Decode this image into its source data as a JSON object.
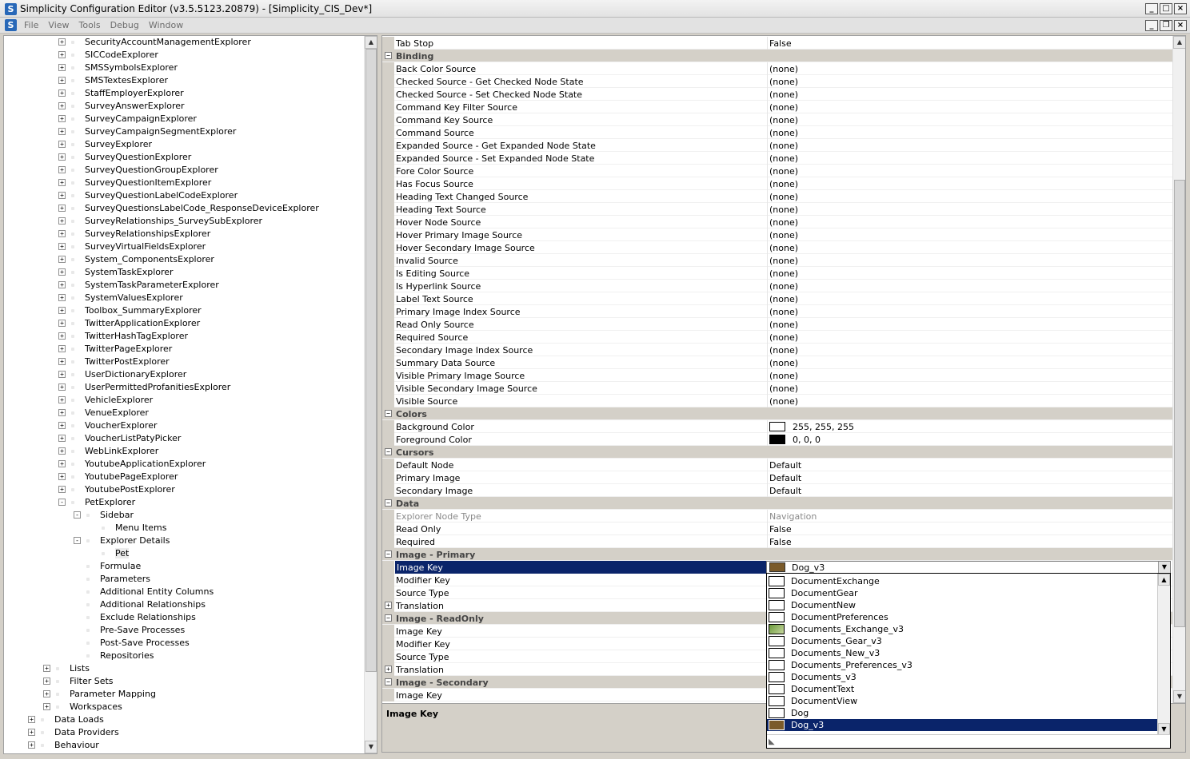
{
  "window": {
    "title": "Simplicity Configuration Editor (v3.5.5123.20879) - [Simplicity_CIS_Dev*]"
  },
  "menu": [
    "File",
    "View",
    "Tools",
    "Debug",
    "Window"
  ],
  "tree": [
    {
      "label": "SecurityAccountManagementExplorer",
      "level": 2,
      "exp": "+"
    },
    {
      "label": "SICCodeExplorer",
      "level": 2,
      "exp": "+"
    },
    {
      "label": "SMSSymbolsExplorer",
      "level": 2,
      "exp": "+"
    },
    {
      "label": "SMSTextesExplorer",
      "level": 2,
      "exp": "+"
    },
    {
      "label": "StaffEmployerExplorer",
      "level": 2,
      "exp": "+"
    },
    {
      "label": "SurveyAnswerExplorer",
      "level": 2,
      "exp": "+"
    },
    {
      "label": "SurveyCampaignExplorer",
      "level": 2,
      "exp": "+"
    },
    {
      "label": "SurveyCampaignSegmentExplorer",
      "level": 2,
      "exp": "+"
    },
    {
      "label": "SurveyExplorer",
      "level": 2,
      "exp": "+"
    },
    {
      "label": "SurveyQuestionExplorer",
      "level": 2,
      "exp": "+"
    },
    {
      "label": "SurveyQuestionGroupExplorer",
      "level": 2,
      "exp": "+"
    },
    {
      "label": "SurveyQuestionItemExplorer",
      "level": 2,
      "exp": "+"
    },
    {
      "label": "SurveyQuestionLabelCodeExplorer",
      "level": 2,
      "exp": "+"
    },
    {
      "label": "SurveyQuestionsLabelCode_ResponseDeviceExplorer",
      "level": 2,
      "exp": "+"
    },
    {
      "label": "SurveyRelationships_SurveySubExplorer",
      "level": 2,
      "exp": "+"
    },
    {
      "label": "SurveyRelationshipsExplorer",
      "level": 2,
      "exp": "+"
    },
    {
      "label": "SurveyVirtualFieldsExplorer",
      "level": 2,
      "exp": "+"
    },
    {
      "label": "System_ComponentsExplorer",
      "level": 2,
      "exp": "+"
    },
    {
      "label": "SystemTaskExplorer",
      "level": 2,
      "exp": "+"
    },
    {
      "label": "SystemTaskParameterExplorer",
      "level": 2,
      "exp": "+"
    },
    {
      "label": "SystemValuesExplorer",
      "level": 2,
      "exp": "+"
    },
    {
      "label": "Toolbox_SummaryExplorer",
      "level": 2,
      "exp": "+"
    },
    {
      "label": "TwitterApplicationExplorer",
      "level": 2,
      "exp": "+"
    },
    {
      "label": "TwitterHashTagExplorer",
      "level": 2,
      "exp": "+"
    },
    {
      "label": "TwitterPageExplorer",
      "level": 2,
      "exp": "+"
    },
    {
      "label": "TwitterPostExplorer",
      "level": 2,
      "exp": "+"
    },
    {
      "label": "UserDictionaryExplorer",
      "level": 2,
      "exp": "+"
    },
    {
      "label": "UserPermittedProfanitiesExplorer",
      "level": 2,
      "exp": "+"
    },
    {
      "label": "VehicleExplorer",
      "level": 2,
      "exp": "+"
    },
    {
      "label": "VenueExplorer",
      "level": 2,
      "exp": "+"
    },
    {
      "label": "VoucherExplorer",
      "level": 2,
      "exp": "+"
    },
    {
      "label": "VoucherListPatyPicker",
      "level": 2,
      "exp": "+"
    },
    {
      "label": "WebLinkExplorer",
      "level": 2,
      "exp": "+"
    },
    {
      "label": "YoutubeApplicationExplorer",
      "level": 2,
      "exp": "+"
    },
    {
      "label": "YoutubePageExplorer",
      "level": 2,
      "exp": "+"
    },
    {
      "label": "YoutubePostExplorer",
      "level": 2,
      "exp": "+"
    },
    {
      "label": "PetExplorer",
      "level": 2,
      "exp": "-"
    },
    {
      "label": "Sidebar",
      "level": 3,
      "exp": "-"
    },
    {
      "label": "Menu Items",
      "level": 4,
      "exp": ""
    },
    {
      "label": "Explorer Details",
      "level": 3,
      "exp": "-"
    },
    {
      "label": "Pet",
      "level": 4,
      "exp": "",
      "selected": true
    },
    {
      "label": "Formulae",
      "level": 3,
      "exp": ""
    },
    {
      "label": "Parameters",
      "level": 3,
      "exp": ""
    },
    {
      "label": "Additional Entity Columns",
      "level": 3,
      "exp": ""
    },
    {
      "label": "Additional Relationships",
      "level": 3,
      "exp": ""
    },
    {
      "label": "Exclude Relationships",
      "level": 3,
      "exp": ""
    },
    {
      "label": "Pre-Save Processes",
      "level": 3,
      "exp": ""
    },
    {
      "label": "Post-Save Processes",
      "level": 3,
      "exp": ""
    },
    {
      "label": "Repositories",
      "level": 3,
      "exp": ""
    },
    {
      "label": "Lists",
      "level": 1,
      "exp": "+"
    },
    {
      "label": "Filter Sets",
      "level": 1,
      "exp": "+"
    },
    {
      "label": "Parameter Mapping",
      "level": 1,
      "exp": "+"
    },
    {
      "label": "Workspaces",
      "level": 1,
      "exp": "+"
    },
    {
      "label": "Data Loads",
      "level": 0,
      "exp": "+"
    },
    {
      "label": "Data Providers",
      "level": 0,
      "exp": "+"
    },
    {
      "label": "Behaviour",
      "level": 0,
      "exp": "+"
    }
  ],
  "props": [
    {
      "name": "Tab Stop",
      "value": "False"
    },
    {
      "cat": true,
      "name": "Binding"
    },
    {
      "name": "Back Color Source",
      "value": "(none)"
    },
    {
      "name": "Checked Source - Get Checked Node State",
      "value": "(none)"
    },
    {
      "name": "Checked Source - Set Checked Node State",
      "value": "(none)"
    },
    {
      "name": "Command Key Filter Source",
      "value": "(none)"
    },
    {
      "name": "Command Key Source",
      "value": "(none)"
    },
    {
      "name": "Command Source",
      "value": "(none)"
    },
    {
      "name": "Expanded Source - Get Expanded Node State",
      "value": "(none)"
    },
    {
      "name": "Expanded Source - Set Expanded Node State",
      "value": "(none)"
    },
    {
      "name": "Fore Color Source",
      "value": "(none)"
    },
    {
      "name": "Has Focus Source",
      "value": "(none)"
    },
    {
      "name": "Heading Text Changed Source",
      "value": "(none)"
    },
    {
      "name": "Heading Text Source",
      "value": "(none)"
    },
    {
      "name": "Hover Node Source",
      "value": "(none)"
    },
    {
      "name": "Hover Primary Image Source",
      "value": "(none)"
    },
    {
      "name": "Hover Secondary Image Source",
      "value": "(none)"
    },
    {
      "name": "Invalid Source",
      "value": "(none)"
    },
    {
      "name": "Is Editing Source",
      "value": "(none)"
    },
    {
      "name": "Is Hyperlink Source",
      "value": "(none)"
    },
    {
      "name": "Label Text Source",
      "value": "(none)"
    },
    {
      "name": "Primary Image Index Source",
      "value": "(none)"
    },
    {
      "name": "Read Only Source",
      "value": "(none)"
    },
    {
      "name": "Required Source",
      "value": "(none)"
    },
    {
      "name": "Secondary Image Index Source",
      "value": "(none)"
    },
    {
      "name": "Summary Data Source",
      "value": "(none)"
    },
    {
      "name": "Visible Primary Image Source",
      "value": "(none)"
    },
    {
      "name": "Visible Secondary Image Source",
      "value": "(none)"
    },
    {
      "name": "Visible Source",
      "value": "(none)"
    },
    {
      "cat": true,
      "name": "Colors"
    },
    {
      "name": "Background Color",
      "value": "255, 255, 255",
      "swatch": "#ffffff"
    },
    {
      "name": "Foreground Color",
      "value": "0, 0, 0",
      "swatch": "#000000"
    },
    {
      "cat": true,
      "name": "Cursors"
    },
    {
      "name": "Default Node",
      "value": "Default"
    },
    {
      "name": "Primary Image",
      "value": "Default"
    },
    {
      "name": "Secondary Image",
      "value": "Default"
    },
    {
      "cat": true,
      "name": "Data"
    },
    {
      "name": "Explorer Node Type",
      "value": "Navigation",
      "grey": true
    },
    {
      "name": "Read Only",
      "value": "False"
    },
    {
      "name": "Required",
      "value": "False"
    },
    {
      "cat": true,
      "name": "Image - Primary"
    },
    {
      "name": "Image Key",
      "value": "",
      "selected": true
    },
    {
      "name": "Modifier Key",
      "value": ""
    },
    {
      "name": "Source Type",
      "value": ""
    },
    {
      "name": "Translation",
      "value": "",
      "sub": "+"
    },
    {
      "cat": true,
      "name": "Image - ReadOnly"
    },
    {
      "name": "Image Key",
      "value": ""
    },
    {
      "name": "Modifier Key",
      "value": ""
    },
    {
      "name": "Source Type",
      "value": ""
    },
    {
      "name": "Translation",
      "value": "",
      "sub": "+"
    },
    {
      "cat": true,
      "name": "Image - Secondary"
    },
    {
      "name": "Image Key",
      "value": ""
    }
  ],
  "combo": {
    "value": "Dog_v3"
  },
  "dropdown": [
    {
      "label": "DocumentExchange"
    },
    {
      "label": "DocumentGear"
    },
    {
      "label": "DocumentNew"
    },
    {
      "label": "DocumentPreferences"
    },
    {
      "label": "Documents_Exchange_v3",
      "img": true
    },
    {
      "label": "Documents_Gear_v3"
    },
    {
      "label": "Documents_New_v3"
    },
    {
      "label": "Documents_Preferences_v3"
    },
    {
      "label": "Documents_v3"
    },
    {
      "label": "DocumentText"
    },
    {
      "label": "DocumentView"
    },
    {
      "label": "Dog"
    },
    {
      "label": "Dog_v3",
      "selected": true
    }
  ],
  "description": {
    "title": "Image Key"
  },
  "colors": {
    "selection": "#0a246a",
    "category_bg": "#d4d0c8"
  }
}
